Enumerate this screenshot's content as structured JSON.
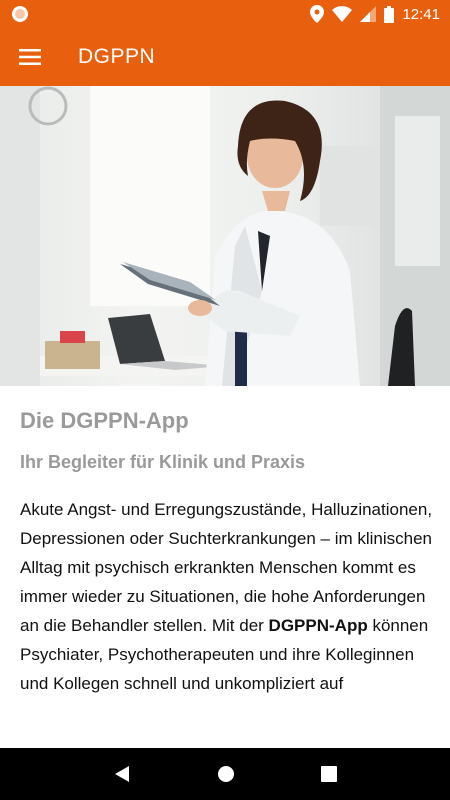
{
  "status_bar": {
    "time": "12:41",
    "icons": [
      "notification-icon",
      "location-icon",
      "wifi-icon",
      "cellular-icon",
      "battery-icon"
    ]
  },
  "app_bar": {
    "title": "DGPPN",
    "menu_icon": "hamburger-menu-icon",
    "color": "#e8600d"
  },
  "hero": {
    "image": "doctor-with-tablet-photo"
  },
  "content": {
    "heading": "Die DGPPN-App",
    "subheading": "Ihr Begleiter für Klinik und Praxis",
    "paragraph_part1": "Akute Angst- und Erregungszustände, Halluzinationen, Depressionen oder Suchterkrankungen – im klinischen Alltag mit psychisch erkrankten Menschen kommt es immer wieder zu Situationen, die hohe Anforderungen an die Behandler stellen. Mit der ",
    "paragraph_bold": "DGPPN-App",
    "paragraph_part2": " können Psychiater, Psychotherapeuten und ihre Kolleginnen und Kollegen schnell und unkompliziert auf"
  },
  "nav_bar": {
    "back_icon": "back-icon",
    "home_icon": "home-icon",
    "recents_icon": "recents-icon"
  }
}
